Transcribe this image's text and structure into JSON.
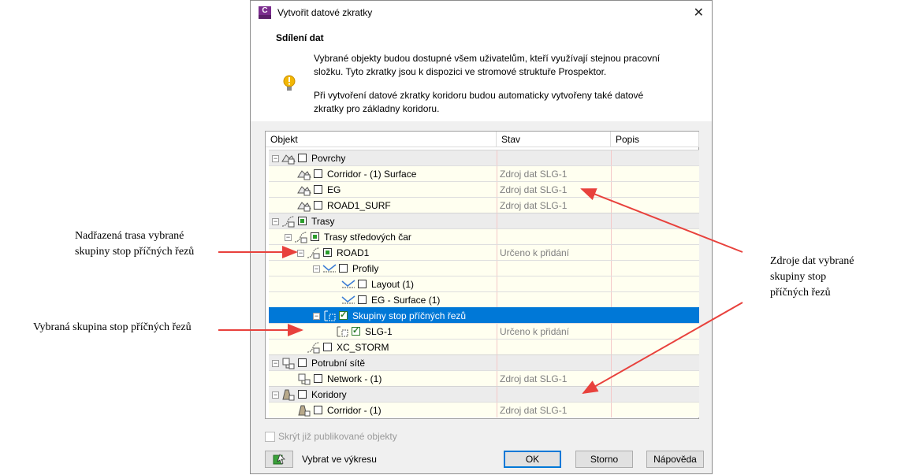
{
  "annotations": {
    "parent_alignment": [
      "Nadřazená trasa vybrané",
      "skupiny stop příčných řezů"
    ],
    "selected_group": "Vybraná skupina stop příčných řezů",
    "data_sources": [
      "Zdroje dat vybrané",
      "skupiny stop",
      "příčných řezů"
    ]
  },
  "dialog": {
    "title": "Vytvořit datové zkratky",
    "header_title": "Sdílení dat",
    "para1": [
      "Vybrané objekty budou dostupné všem uživatelům, kteří využívají stejnou pracovní",
      "složku. Tyto zkratky jsou k dispozici ve stromové struktuře Prospektor."
    ],
    "para2": [
      "Při vytvoření datové zkratky koridoru budou automaticky vytvořeny také datové",
      "zkratky pro základny koridoru."
    ],
    "columns": [
      "Objekt",
      "Stav",
      "Popis"
    ],
    "rows": [
      {
        "label": "Povrchy",
        "stav": ""
      },
      {
        "label": "Corridor - (1) Surface",
        "stav": "Zdroj dat SLG-1"
      },
      {
        "label": "EG",
        "stav": "Zdroj dat SLG-1"
      },
      {
        "label": "ROAD1_SURF",
        "stav": "Zdroj dat SLG-1"
      },
      {
        "label": "Trasy",
        "stav": ""
      },
      {
        "label": "Trasy středových čar",
        "stav": ""
      },
      {
        "label": "ROAD1",
        "stav": "Určeno k přidání"
      },
      {
        "label": "Profily",
        "stav": ""
      },
      {
        "label": "Layout (1)",
        "stav": ""
      },
      {
        "label": "EG - Surface (1)",
        "stav": ""
      },
      {
        "label": "Skupiny stop příčných řezů",
        "stav": ""
      },
      {
        "label": "SLG-1",
        "stav": "Určeno k přidání"
      },
      {
        "label": "XC_STORM",
        "stav": ""
      },
      {
        "label": "Potrubní sítě",
        "stav": ""
      },
      {
        "label": "Network - (1)",
        "stav": "Zdroj dat SLG-1"
      },
      {
        "label": "Koridory",
        "stav": ""
      },
      {
        "label": "Corridor - (1)",
        "stav": "Zdroj dat SLG-1"
      }
    ],
    "hide_published": "Skrýt již publikované objekty",
    "select_in_drawing": "Vybrat ve výkresu",
    "ok": "OK",
    "cancel": "Storno",
    "help": "Nápověda"
  },
  "colors": {
    "accent": "#0078d7",
    "arrow": "#e8413c"
  }
}
